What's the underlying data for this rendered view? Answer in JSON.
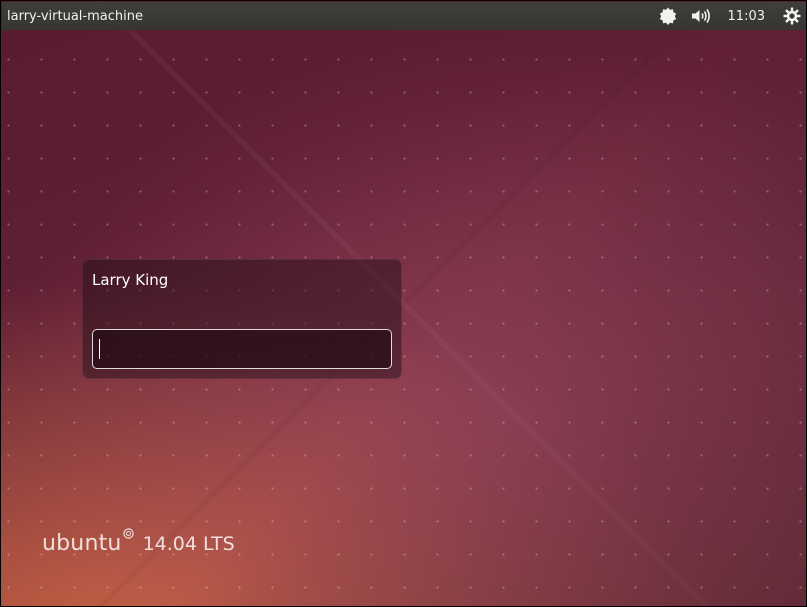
{
  "topbar": {
    "hostname": "larry-virtual-machine",
    "clock": "11:03",
    "icons": [
      "accessibility-icon",
      "volume-icon",
      "power-icon"
    ]
  },
  "login": {
    "username": "Larry King",
    "password_value": ""
  },
  "branding": {
    "name": "ubuntu",
    "version": "14.04 LTS"
  },
  "colors": {
    "topbar": "#3c3b37",
    "text": "#ffffff"
  }
}
